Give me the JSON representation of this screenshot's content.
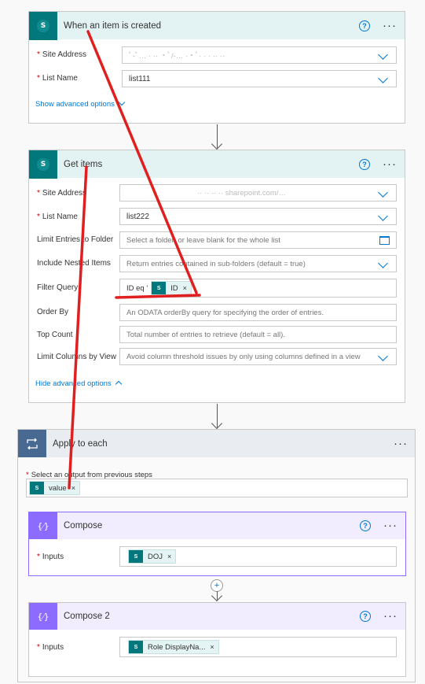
{
  "trigger": {
    "title": "When an item is created",
    "site_label": "Site Address",
    "site_value": "ﾟ-ﾟ… · ·· ·ﾟ/-… ··ﾟ· · · ·· ··",
    "list_label": "List Name",
    "list_value": "list111",
    "advanced": "Show advanced options"
  },
  "get_items": {
    "title": "Get items",
    "fields": [
      {
        "label": "Site Address",
        "required": "*",
        "value": "·· ·· ·· ·· sharepoint.com/…",
        "placeholder": ""
      },
      {
        "label": "List Name",
        "required": "*",
        "value": "list222",
        "placeholder": ""
      },
      {
        "label": "Limit Entries to Folder",
        "required": "",
        "value": "",
        "placeholder": "Select a folder, or leave blank for the whole list"
      },
      {
        "label": "Include Nested Items",
        "required": "",
        "value": "",
        "placeholder": "Return entries contained in sub-folders (default = true)"
      },
      {
        "label": "Filter Query",
        "required": "",
        "value": "",
        "placeholder": ""
      },
      {
        "label": "Order By",
        "required": "",
        "value": "",
        "placeholder": "An ODATA orderBy query for specifying the order of entries."
      },
      {
        "label": "Top Count",
        "required": "",
        "value": "",
        "placeholder": "Total number of entries to retrieve (default = all)."
      },
      {
        "label": "Limit Columns by View",
        "required": "",
        "value": "",
        "placeholder": "Avoid column threshold issues by only using columns defined in a view"
      }
    ],
    "filter_prefix": "ID eq '",
    "filter_token": "ID",
    "filter_suffix": "'",
    "advanced": "Hide advanced options"
  },
  "apply_each": {
    "title": "Apply to each",
    "select_label": "Select an output from previous steps",
    "token": "value"
  },
  "compose1": {
    "title": "Compose",
    "inputs_label": "Inputs",
    "token": "DOJ"
  },
  "compose2": {
    "title": "Compose 2",
    "inputs_label": "Inputs",
    "token": "Role DisplayNa..."
  },
  "icons": {
    "help": "?",
    "more": "···",
    "token_close": "×",
    "sp_letter": "S",
    "compose_glyph": "{⁄}",
    "add": "+"
  },
  "colors": {
    "sharepoint": "#03787c",
    "compose": "#8c6cff",
    "loop": "#486991",
    "link": "#0078d4",
    "required": "#c00000",
    "annotation": "#e02020"
  }
}
